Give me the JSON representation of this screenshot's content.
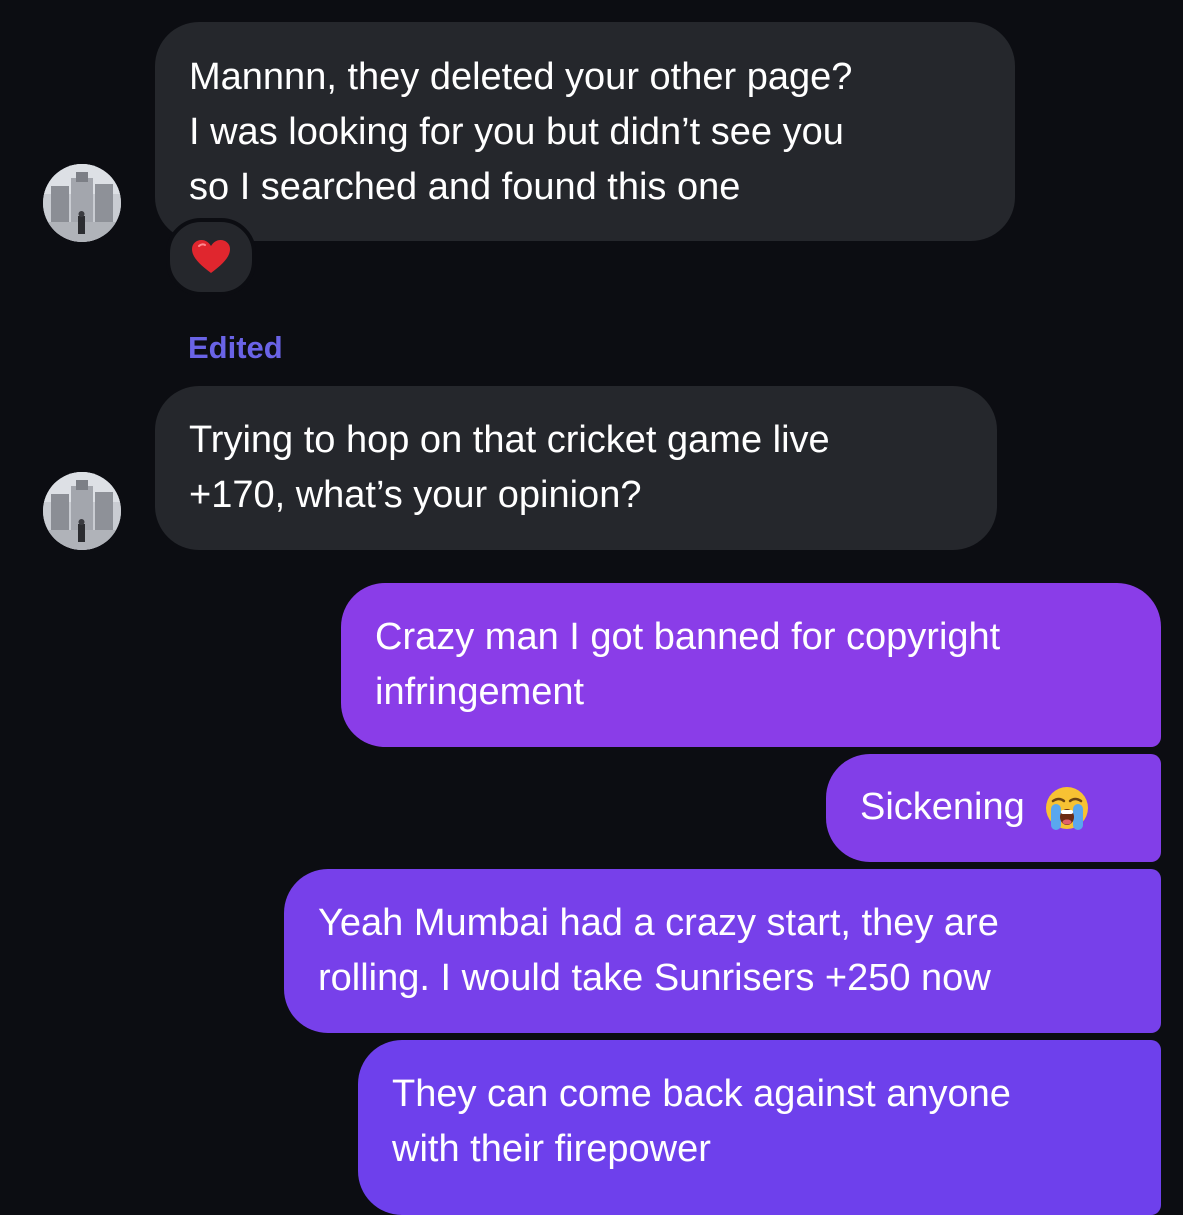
{
  "conversation": {
    "incoming": [
      {
        "lines": [
          "Mannnn, they deleted your other page?",
          "I was looking for you but didn’t see you",
          "so  I searched and found this one"
        ],
        "reaction_icon": "red-heart-icon"
      },
      {
        "edited_label": "Edited",
        "lines": [
          "Trying to hop on that cricket game live",
          "+170, what’s your opinion?"
        ]
      }
    ],
    "outgoing": [
      {
        "lines": [
          "Crazy man I got banned for copyright",
          "infringement"
        ]
      },
      {
        "lines": [
          "Sickening"
        ],
        "emoji": "loudly-crying-face-icon"
      },
      {
        "lines": [
          "Yeah Mumbai had a crazy start, they are",
          "rolling. I would take Sunrisers +250 now"
        ]
      },
      {
        "lines": [
          "They can come back against anyone",
          "with their firepower"
        ]
      }
    ]
  },
  "colors": {
    "background": "#0c0d12",
    "incoming_bubble": "#25272c",
    "outgoing_bubble_top": "#8a3de8",
    "outgoing_bubble_bottom": "#6e40ec",
    "edited_label": "#6a63e6",
    "heart": "#e0262e"
  }
}
